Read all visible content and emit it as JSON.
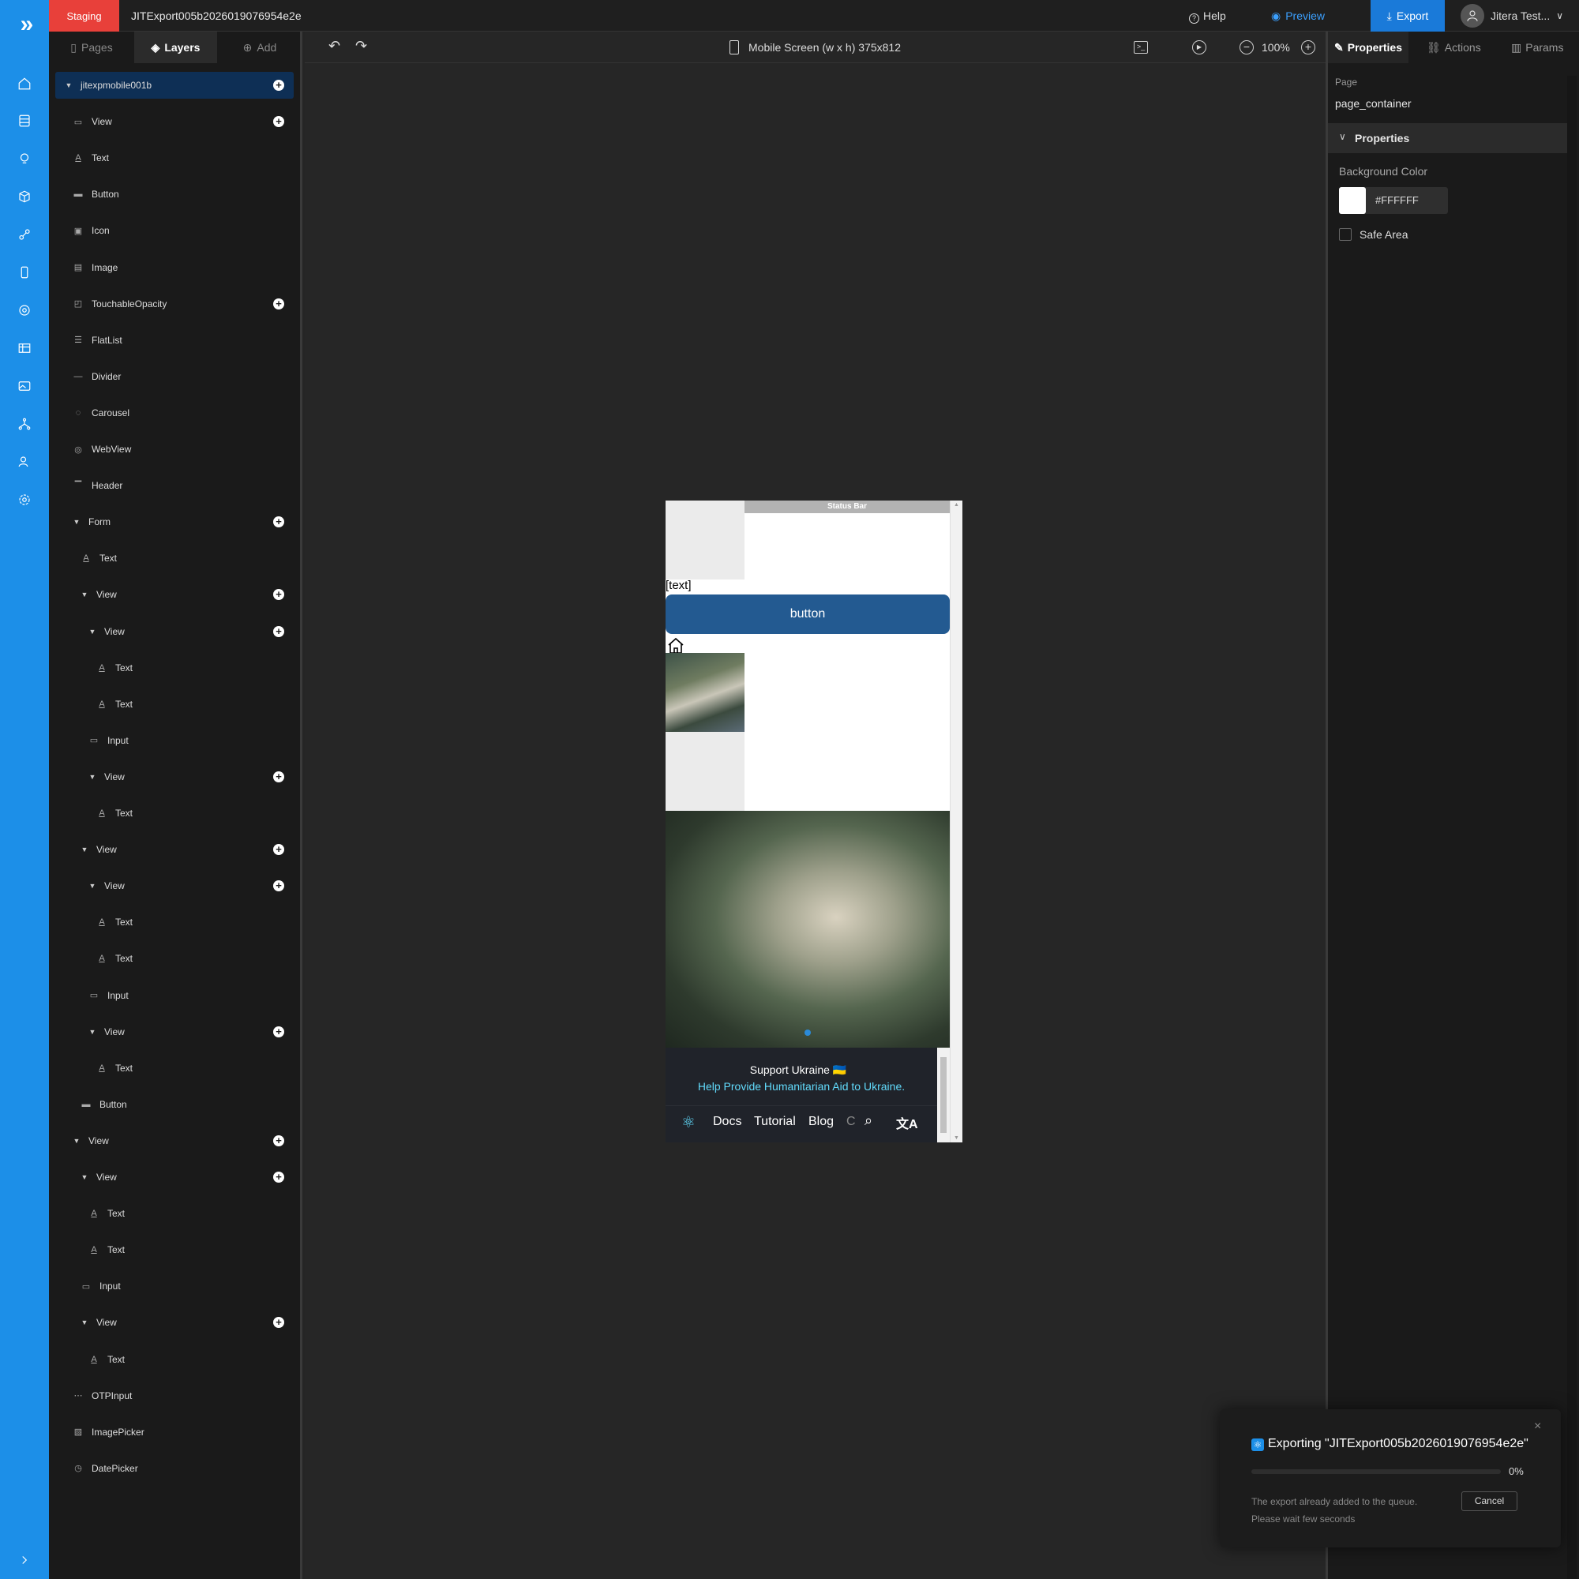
{
  "topbar": {
    "environment": "Staging",
    "project_name": "JITExport005b2026019076954e2e",
    "help_label": "Help",
    "preview_label": "Preview",
    "export_label": "Export",
    "user_name": "Jitera Test..."
  },
  "left_panel": {
    "tabs": [
      {
        "label": "Pages",
        "icon": "page-icon"
      },
      {
        "label": "Layers",
        "icon": "layers-icon"
      },
      {
        "label": "Add",
        "icon": "plus-circle-icon"
      }
    ],
    "layers": [
      {
        "label": "jitexpmobile001b",
        "indent": 0,
        "expanded": true,
        "icon": "",
        "add": true,
        "selected": true
      },
      {
        "label": "View",
        "indent": 1,
        "icon": "view-icon",
        "add": true
      },
      {
        "label": "Text",
        "indent": 1,
        "icon": "text-icon"
      },
      {
        "label": "Button",
        "indent": 1,
        "icon": "button-icon"
      },
      {
        "label": "Icon",
        "indent": 1,
        "icon": "icon-icon"
      },
      {
        "label": "Image",
        "indent": 1,
        "icon": "image-icon"
      },
      {
        "label": "TouchableOpacity",
        "indent": 1,
        "icon": "touchable-icon",
        "add": true
      },
      {
        "label": "FlatList",
        "indent": 1,
        "icon": "list-icon"
      },
      {
        "label": "Divider",
        "indent": 1,
        "icon": "divider-icon"
      },
      {
        "label": "Carousel",
        "indent": 1,
        "icon": "carousel-icon"
      },
      {
        "label": "WebView",
        "indent": 1,
        "icon": "globe-icon"
      },
      {
        "label": "Header",
        "indent": 1,
        "icon": "header-icon"
      },
      {
        "label": "Form",
        "indent": 1,
        "expanded": true,
        "add": true
      },
      {
        "label": "Text",
        "indent": 2,
        "icon": "text-icon"
      },
      {
        "label": "View",
        "indent": 2,
        "expanded": true,
        "add": true
      },
      {
        "label": "View",
        "indent": 3,
        "expanded": true,
        "add": true
      },
      {
        "label": "Text",
        "indent": 4,
        "icon": "text-icon"
      },
      {
        "label": "Text",
        "indent": 4,
        "icon": "text-icon"
      },
      {
        "label": "Input",
        "indent": 3,
        "icon": "input-icon"
      },
      {
        "label": "View",
        "indent": 3,
        "expanded": true,
        "add": true
      },
      {
        "label": "Text",
        "indent": 4,
        "icon": "text-icon"
      },
      {
        "label": "View",
        "indent": 2,
        "expanded": true,
        "add": true
      },
      {
        "label": "View",
        "indent": 3,
        "expanded": true,
        "add": true
      },
      {
        "label": "Text",
        "indent": 4,
        "icon": "text-icon"
      },
      {
        "label": "Text",
        "indent": 4,
        "icon": "text-icon"
      },
      {
        "label": "Input",
        "indent": 3,
        "icon": "input-icon"
      },
      {
        "label": "View",
        "indent": 3,
        "expanded": true,
        "add": true
      },
      {
        "label": "Text",
        "indent": 4,
        "icon": "text-icon"
      },
      {
        "label": "Button",
        "indent": 2,
        "icon": "button-icon"
      },
      {
        "label": "View",
        "indent": 1,
        "expanded": true,
        "add": true
      },
      {
        "label": "View",
        "indent": 2,
        "expanded": true,
        "add": true
      },
      {
        "label": "Text",
        "indent": 3,
        "icon": "text-icon"
      },
      {
        "label": "Text",
        "indent": 3,
        "icon": "text-icon"
      },
      {
        "label": "Input",
        "indent": 2,
        "icon": "input-icon"
      },
      {
        "label": "View",
        "indent": 2,
        "expanded": true,
        "add": true
      },
      {
        "label": "Text",
        "indent": 3,
        "icon": "text-icon"
      },
      {
        "label": "OTPInput",
        "indent": 1,
        "icon": "otp-icon"
      },
      {
        "label": "ImagePicker",
        "indent": 1,
        "icon": "image-picker-icon"
      },
      {
        "label": "DatePicker",
        "indent": 1,
        "icon": "clock-icon"
      }
    ]
  },
  "canvas": {
    "device_label": "Mobile Screen (w x h) 375x812",
    "zoom": "100%",
    "phone": {
      "status_bar": "Status Bar",
      "text_placeholder": "[text]",
      "button_label": "button",
      "support_title": "Support Ukraine 🇺🇦",
      "support_link": "Help Provide Humanitarian Aid to Ukraine.",
      "nav": [
        "Docs",
        "Tutorial",
        "Blog",
        "C"
      ]
    }
  },
  "right_panel": {
    "tabs": [
      {
        "label": "Properties",
        "icon": "brush-icon"
      },
      {
        "label": "Actions",
        "icon": "link-icon"
      },
      {
        "label": "Params",
        "icon": "params-icon"
      }
    ],
    "page_label": "Page",
    "page_value": "page_container",
    "section_title": "Properties",
    "bg_color_label": "Background Color",
    "bg_color_value": "#FFFFFF",
    "safe_area_label": "Safe Area",
    "safe_area_checked": false
  },
  "toast": {
    "title": "Exporting \"JITExport005b2026019076954e2e\"",
    "progress": 0,
    "progress_text": "0%",
    "message_line1": "The export already added to the queue.",
    "message_line2": "Please wait few seconds",
    "cancel_label": "Cancel"
  },
  "colors": {
    "accent": "#1c8fe8",
    "staging": "#e8403a",
    "phone_button": "#235a91",
    "selected_layer": "#0e2f55"
  }
}
